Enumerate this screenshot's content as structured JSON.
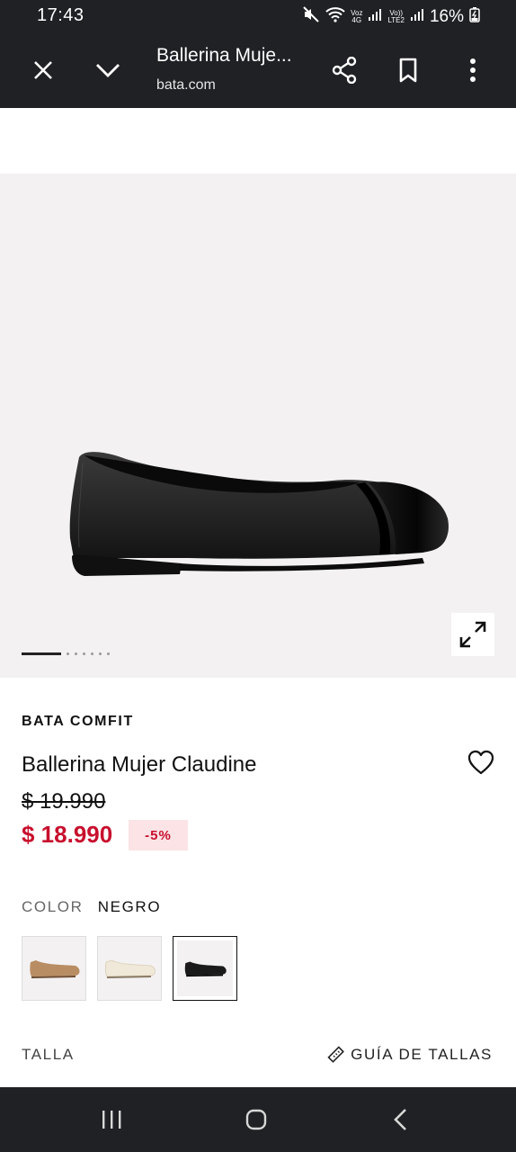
{
  "status": {
    "time": "17:43",
    "battery": "16%",
    "voz": "Voz",
    "net4g": "4G",
    "volte": "Vo))",
    "lte2": "LTE2"
  },
  "browser": {
    "title": "Ballerina Muje...",
    "url": "bata.com",
    "icons": [
      "close-icon",
      "chevron-down-icon",
      "share-icon",
      "bookmark-icon",
      "more-vert-icon"
    ]
  },
  "gallery": {
    "image": "black-ballerina-shoe",
    "pages": 7,
    "current": 1
  },
  "product": {
    "brand": "BATA COMFIT",
    "name": "Ballerina Mujer Claudine",
    "old_price": "$ 19.990",
    "price": "$ 18.990",
    "discount": "-5%",
    "color_label": "COLOR",
    "color_value": "NEGRO",
    "swatches": [
      "tan",
      "cream",
      "black"
    ],
    "selected_swatch": "black",
    "size_label": "TALLA",
    "size_guide": "GUÍA DE TALLAS"
  },
  "colors": {
    "sale": "#c8102e",
    "bar": "#1f2124",
    "gallery_bg": "#f3f1f2"
  }
}
